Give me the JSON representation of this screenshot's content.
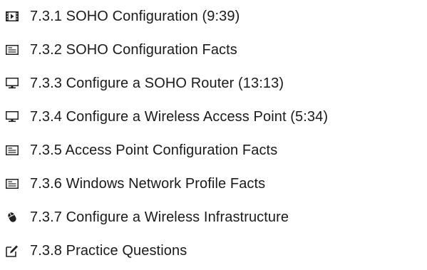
{
  "items": [
    {
      "label": "7.3.1 SOHO Configuration (9:39)",
      "icon": "video-icon"
    },
    {
      "label": "7.3.2 SOHO Configuration Facts",
      "icon": "document-icon"
    },
    {
      "label": "7.3.3 Configure a SOHO Router (13:13)",
      "icon": "monitor-icon"
    },
    {
      "label": "7.3.4 Configure a Wireless Access Point (5:34)",
      "icon": "monitor-icon"
    },
    {
      "label": "7.3.5 Access Point Configuration Facts",
      "icon": "document-icon"
    },
    {
      "label": "7.3.6 Windows Network Profile Facts",
      "icon": "document-icon"
    },
    {
      "label": "7.3.7 Configure a Wireless Infrastructure",
      "icon": "mouse-icon"
    },
    {
      "label": "7.3.8 Practice Questions",
      "icon": "edit-icon"
    }
  ]
}
